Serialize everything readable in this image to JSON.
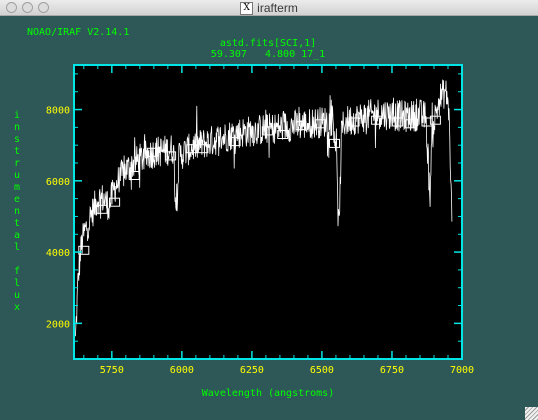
{
  "window": {
    "title": "irafterm",
    "title_icon": "x11-icon",
    "title_icon_glyph": "X"
  },
  "terminal": {
    "version_text": "NOAO/IRAF V2.14.1"
  },
  "colors": {
    "background": "#2e5758",
    "plot_bg": "#000000",
    "frame": "#00e5e5",
    "text_green": "#00ff00",
    "tick_yellow": "#ffff00",
    "data": "#ffffff"
  },
  "chart_data": {
    "type": "line",
    "title": "astd.fits[SCI,1]",
    "subtitle": "59.307   4.800 17_1",
    "xlabel": "Wavelength (angstroms)",
    "ylabel": "instrumental flux",
    "xlim": [
      5615,
      7000
    ],
    "ylim": [
      1000,
      9250
    ],
    "x_ticks": [
      5750,
      6000,
      6250,
      6500,
      6750,
      7000
    ],
    "y_ticks": [
      2000,
      4000,
      6000,
      8000
    ],
    "series": [
      {
        "x": [
          5620,
          5630,
          5640,
          5650,
          5660,
          5680,
          5700,
          5720,
          5740,
          5760,
          5780,
          5800,
          5830,
          5860,
          5900,
          5940,
          5970,
          5980,
          5990,
          6000,
          6040,
          6080,
          6120,
          6160,
          6200,
          6250,
          6300,
          6350,
          6400,
          6450,
          6500,
          6540,
          6550,
          6555,
          6560,
          6565,
          6570,
          6580,
          6600,
          6650,
          6700,
          6750,
          6800,
          6850,
          6870,
          6880,
          6885,
          6890,
          6900,
          6920,
          6940,
          6950,
          6955,
          6960,
          6965
        ],
        "y": [
          1500,
          3300,
          4100,
          4500,
          4700,
          5100,
          5500,
          5500,
          5300,
          5800,
          6100,
          6300,
          6500,
          6650,
          6800,
          6850,
          6900,
          5100,
          6700,
          6750,
          6950,
          7050,
          7150,
          7250,
          7350,
          7400,
          7450,
          7500,
          7550,
          7600,
          7650,
          7700,
          7000,
          5700,
          4600,
          5800,
          7400,
          7650,
          7700,
          7800,
          7900,
          7850,
          7800,
          7850,
          7800,
          6500,
          5400,
          6800,
          7650,
          8300,
          8500,
          8300,
          7600,
          6000,
          4600
        ]
      }
    ],
    "markers": {
      "x": [
        5650,
        5715,
        5760,
        5830,
        5895,
        5960,
        6035,
        6075,
        6190,
        6305,
        6360,
        6425,
        6495,
        6545,
        6615,
        6695,
        6770,
        6815,
        6875,
        6905
      ],
      "y": [
        4050,
        5200,
        5400,
        6150,
        6800,
        6700,
        6900,
        6900,
        7100,
        7400,
        7300,
        7550,
        7600,
        7050,
        7650,
        7700,
        7650,
        7600,
        7650,
        7700
      ]
    }
  }
}
